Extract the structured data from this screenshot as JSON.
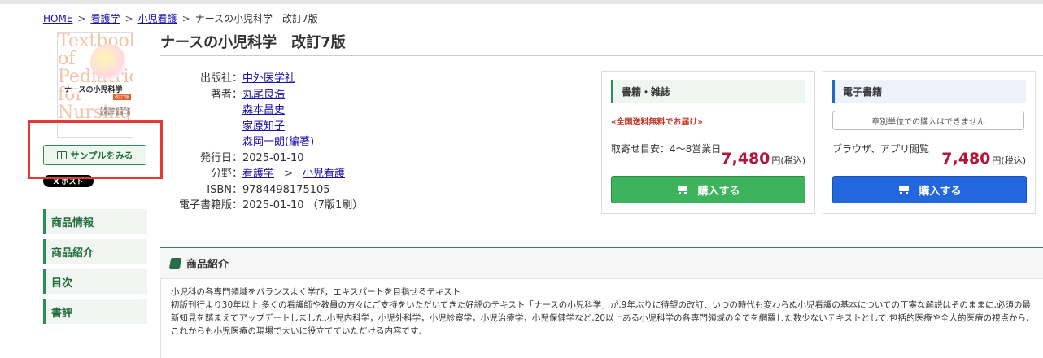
{
  "breadcrumb": {
    "home": "HOME",
    "sep": ">",
    "c1": "看護学",
    "c2": "小児看護",
    "current": "ナースの小児科学　改訂7版"
  },
  "cover": {
    "bg_text": "Textbook of Pediatrics for Nursing",
    "title": "ナースの小児科学",
    "edition": "改訂7版",
    "authors": "丸尾良浩 森本昌史 家原知子 森岡一朗"
  },
  "sample_button": "サンプルをみる",
  "post_button": "X ポスト",
  "sidenav": [
    "商品情報",
    "商品紹介",
    "目次",
    "書評"
  ],
  "product": {
    "title": "ナースの小児科学　改訂7版",
    "labels": {
      "publisher": "出版社：",
      "authors": "著者：",
      "date": "発行日：",
      "field": "分野：",
      "isbn": "ISBN：",
      "ebook": "電子書籍版："
    },
    "publisher": "中外医学社",
    "authors": [
      "丸尾良浩",
      "森本昌史",
      "家原知子",
      "森岡一朗(編著)"
    ],
    "date": "2025-01-10",
    "field1": "看護学",
    "field_sep": ">",
    "field2": "小児看護",
    "isbn": "9784498175105",
    "ebook_date": "2025-01-10 （7版1刷）"
  },
  "print_box": {
    "head": "書籍・雑誌",
    "free_ship": "«全国送料無料でお届け»",
    "delivery": "取寄せ目安：4～8営業日",
    "price": "7,480",
    "yen": "円(税込)",
    "buy": "購入する"
  },
  "ebook_box": {
    "head": "電子書籍",
    "notice": "章別単位での購入はできません",
    "format": "ブラウザ、アプリ閲覧",
    "price": "7,480",
    "yen": "円(税込)",
    "buy": "購入する"
  },
  "intro": {
    "head": "商品紹介",
    "line1": "小児科の各専門領域をバランスよく学び，エキスパートを目指せるテキスト",
    "line2": "初版刊行より30年以上,多くの看護師や教員の方々にご支持をいただいてきた好評のテキスト「ナースの小児科学」が,9年ぶりに待望の改訂．いつの時代も変わらぬ小児看護の基本についての丁寧な解説はそのままに,必須の最新知見を踏まえてアップデートしました.小児内科学，小児外科学，小児診察学，小児治療学，小児保健学など,20以上ある小児科学の各専門領域の全てを網羅した数少ないテキストとして,包括的医療や全人的医療の視点から,これからも小児医療の現場で大いに役立てていただける内容です."
  },
  "colors": {
    "accent_green": "#2e8b57",
    "price_red": "#b0183a",
    "buy_green": "#3cb35c",
    "buy_blue": "#2267dd",
    "highlight": "#e53935"
  }
}
